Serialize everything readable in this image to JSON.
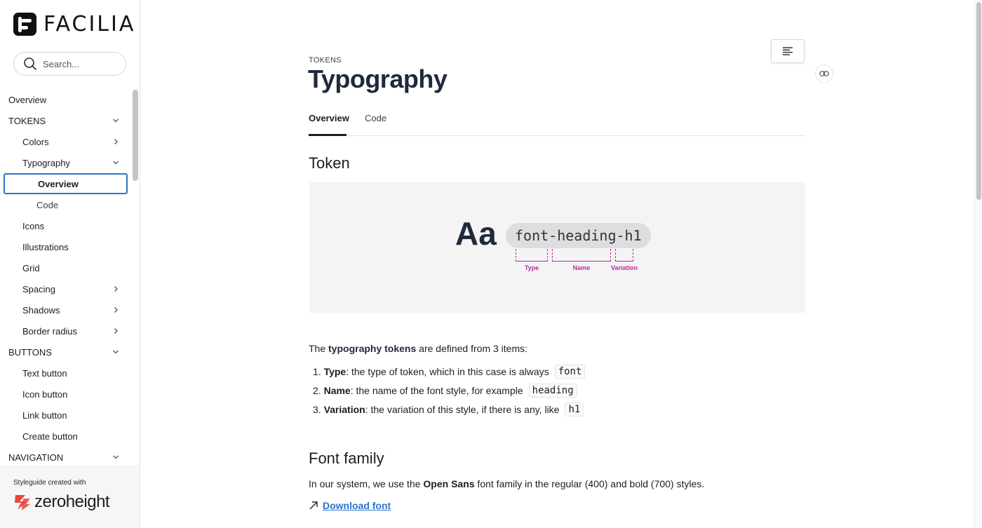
{
  "brand": {
    "name": "FACILIA"
  },
  "search": {
    "placeholder": "Search..."
  },
  "nav": {
    "overview": "Overview",
    "tokens": "TOKENS",
    "colors": "Colors",
    "typography": "Typography",
    "typo_overview": "Overview",
    "typo_code": "Code",
    "icons": "Icons",
    "illustrations": "Illustrations",
    "grid": "Grid",
    "spacing": "Spacing",
    "shadows": "Shadows",
    "border_radius": "Border radius",
    "buttons": "BUTTONS",
    "text_button": "Text button",
    "icon_button": "Icon button",
    "link_button": "Link button",
    "create_button": "Create button",
    "navigation": "NAVIGATION"
  },
  "footer": {
    "credit": "Styleguide created with",
    "brand": "zeroheight"
  },
  "page": {
    "eyebrow": "TOKENS",
    "title": "Typography",
    "tabs": [
      "Overview",
      "Code"
    ]
  },
  "token_section": {
    "heading": "Token",
    "sample": "Aa",
    "token_name": "font-heading-h1",
    "labels": [
      "Type",
      "Name",
      "Variation"
    ]
  },
  "intro": {
    "prefix": "The ",
    "bold": "typography tokens",
    "suffix": " are defined from 3 items:"
  },
  "items": [
    {
      "num": "1. ",
      "term": "Type",
      "text": ": the type of token, which in this case is always",
      "code": "font"
    },
    {
      "num": "2. ",
      "term": "Name",
      "text": ": the name of the font style, for example",
      "code": "heading"
    },
    {
      "num": "3. ",
      "term": "Variation",
      "text": ": the variation of this style, if there is any, like",
      "code": "h1"
    }
  ],
  "font_family": {
    "heading": "Font family",
    "prefix": "In our system, we use the ",
    "bold": "Open Sans",
    "suffix": " font family in the regular (400) and bold (700) styles.",
    "download": "Download font"
  },
  "colors": {
    "accent": "#2b74c8",
    "annotation": "#c026a3",
    "title": "#1f2a3c"
  }
}
